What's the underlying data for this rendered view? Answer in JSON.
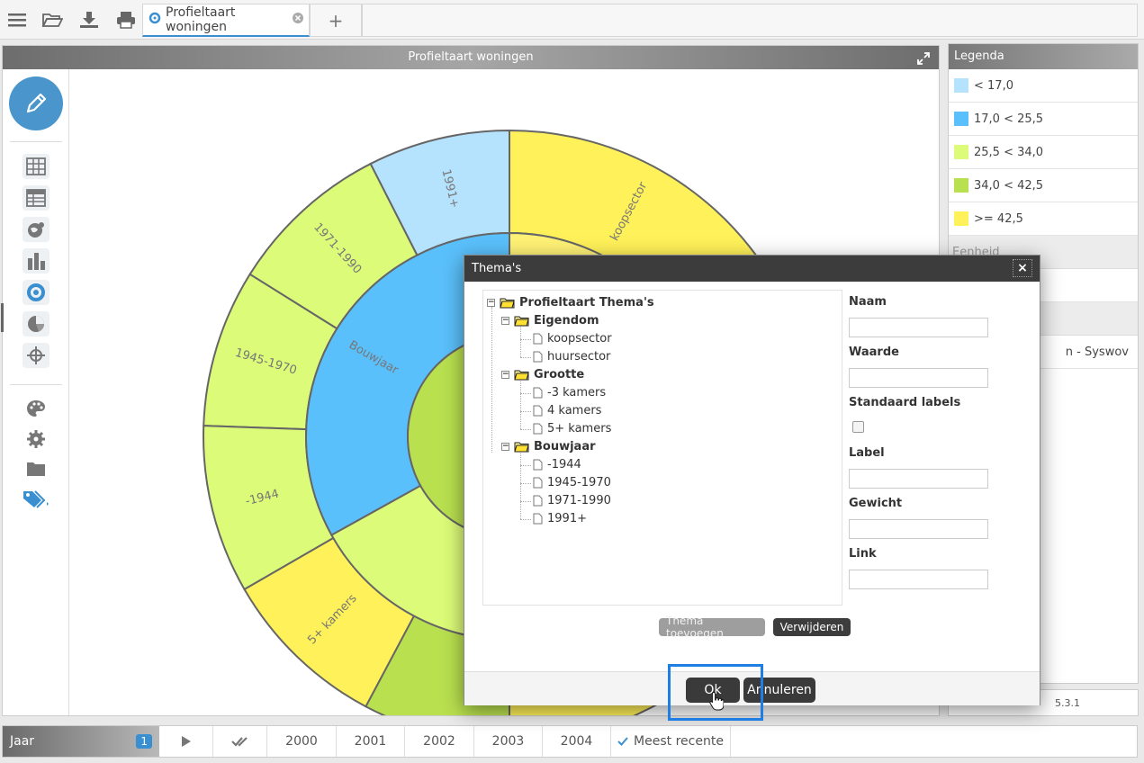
{
  "toolbar": {
    "tab_label": "Profieltaart woningen",
    "tab_add": "+",
    "icons": [
      "menu-icon",
      "folder-open-icon",
      "download-icon",
      "print-icon",
      "tab-chart-icon",
      "tab-close-icon"
    ]
  },
  "main": {
    "title": "Profieltaart woningen",
    "tools": [
      "edit-icon",
      "table-icon",
      "table-alt-icon",
      "map-chart-icon",
      "bar-chart-icon",
      "donut-chart-icon",
      "pie-chart-icon",
      "crosshair-icon",
      "palette-icon",
      "settings-icon",
      "folder-icon",
      "tags-icon"
    ]
  },
  "chart_data": {
    "type": "pie",
    "rings": [
      {
        "name": "inner",
        "segments": [
          {
            "label": "",
            "color": "#b9e04f"
          }
        ]
      },
      {
        "name": "middle",
        "segments": [
          {
            "label": "",
            "color": "#fff275",
            "start": 0,
            "end": 360
          },
          {
            "label": "Bouwjaar",
            "color": "#5ac0fb",
            "start": 180,
            "end": 360
          }
        ]
      },
      {
        "name": "outer",
        "segments": [
          {
            "label": "koopsector",
            "color": "#fff159"
          },
          {
            "label": "1991+",
            "color": "#b5e2fc"
          },
          {
            "label": "1971-1990",
            "color": "#dcfb78"
          },
          {
            "label": "1945-1970",
            "color": "#dcfb78"
          },
          {
            "label": "-1944",
            "color": "#dcfb78"
          },
          {
            "label": "5+ kamers",
            "color": "#fff159"
          }
        ]
      }
    ]
  },
  "legend": {
    "title": "Legenda",
    "items": [
      {
        "label": "< 17,0",
        "color": "#b5e2fc"
      },
      {
        "label": "17,0 < 25,5",
        "color": "#5ac0fb"
      },
      {
        "label": "25,5 < 34,0",
        "color": "#dcfb78"
      },
      {
        "label": "34,0 < 42,5",
        "color": "#b9e04f"
      },
      {
        "label": ">= 42,5",
        "color": "#fff159"
      }
    ],
    "section1": "Eenheid",
    "source_partial": "n - Syswov",
    "footer": "5.3.1"
  },
  "timeline": {
    "label": "Jaar",
    "badge": "1",
    "years": [
      "2000",
      "2001",
      "2002",
      "2003",
      "2004"
    ],
    "latest": "Meest recente"
  },
  "dialog": {
    "title": "Thema's",
    "close": "×",
    "tree": {
      "root": "Profieltaart Thema's",
      "groups": [
        {
          "label": "Eigendom",
          "children": [
            "koopsector",
            "huursector"
          ]
        },
        {
          "label": "Grootte",
          "children": [
            "-3 kamers",
            "4 kamers",
            "5+ kamers"
          ]
        },
        {
          "label": "Bouwjaar",
          "children": [
            "-1944",
            "1945-1970",
            "1971-1990",
            "1991+"
          ]
        }
      ]
    },
    "form": {
      "naam": "Naam",
      "waarde": "Waarde",
      "standaard_labels": "Standaard labels",
      "label": "Label",
      "gewicht": "Gewicht",
      "link": "Link"
    },
    "add_button": "Thema toevoegen",
    "delete_button": "Verwijderen",
    "ok_button": "Ok",
    "cancel_button": "Annuleren"
  }
}
